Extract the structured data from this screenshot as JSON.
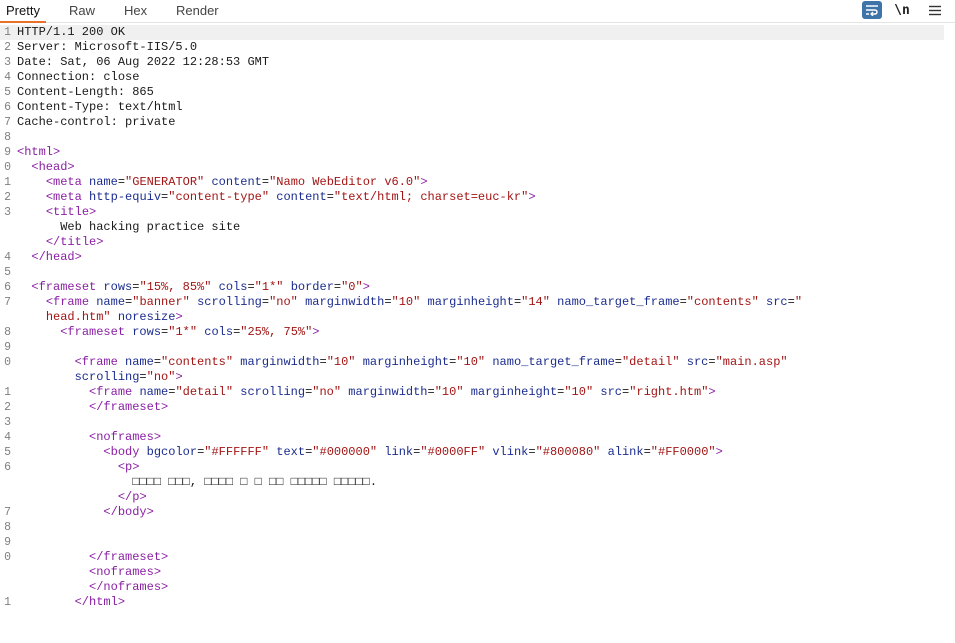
{
  "tabs": [
    {
      "label": "Pretty",
      "active": true
    },
    {
      "label": "Raw",
      "active": false
    },
    {
      "label": "Hex",
      "active": false
    },
    {
      "label": "Render",
      "active": false
    }
  ],
  "toolbar": {
    "newline_label": "\\n",
    "wrap_icon": "word-wrap-icon",
    "menu_icon": "hamburger-menu-icon"
  },
  "colors": {
    "tag": "#8a1fa3",
    "attribute": "#1c2d8f",
    "value": "#a31515",
    "text": "#1a1a1a",
    "accent": "#e8722c"
  },
  "lines": [
    {
      "n": "1",
      "code": "HTTP/1.1 200 OK"
    },
    {
      "n": "2",
      "code": "Server: Microsoft-IIS/5.0"
    },
    {
      "n": "3",
      "code": "Date: Sat, 06 Aug 2022 12:28:53 GMT"
    },
    {
      "n": "4",
      "code": "Connection: close"
    },
    {
      "n": "5",
      "code": "Content-Length: 865"
    },
    {
      "n": "6",
      "code": "Content-Type: text/html"
    },
    {
      "n": "7",
      "code": "Cache-control: private"
    },
    {
      "n": "8",
      "code": ""
    },
    {
      "n": "9",
      "code": "<html>"
    },
    {
      "n": "0",
      "code": "  <head>"
    },
    {
      "n": "1",
      "code": "    <meta name=\"GENERATOR\" content=\"Namo WebEditor v6.0\">"
    },
    {
      "n": "2",
      "code": "    <meta http-equiv=\"content-type\" content=\"text/html; charset=euc-kr\">"
    },
    {
      "n": "3",
      "code": "    <title>"
    },
    {
      "n": "",
      "code": "      Web hacking practice site"
    },
    {
      "n": "",
      "code": "    </title>"
    },
    {
      "n": "4",
      "code": "  </head>"
    },
    {
      "n": "5",
      "code": ""
    },
    {
      "n": "6",
      "code": "  <frameset rows=\"15%, 85%\" cols=\"1*\" border=\"0\">"
    },
    {
      "n": "7",
      "code": "    <frame name=\"banner\" scrolling=\"no\" marginwidth=\"10\" marginheight=\"14\" namo_target_frame=\"contents\" src=\""
    },
    {
      "n": "",
      "code": "    head.htm\" noresize>"
    },
    {
      "n": "8",
      "code": "      <frameset rows=\"1*\" cols=\"25%, 75%\">"
    },
    {
      "n": "9",
      "code": ""
    },
    {
      "n": "0",
      "code": "        <frame name=\"contents\" marginwidth=\"10\" marginheight=\"10\" namo_target_frame=\"detail\" src=\"main.asp\""
    },
    {
      "n": "",
      "code": "        scrolling=\"no\">"
    },
    {
      "n": "1",
      "code": "          <frame name=\"detail\" scrolling=\"no\" marginwidth=\"10\" marginheight=\"10\" src=\"right.htm\">"
    },
    {
      "n": "2",
      "code": "          </frameset>"
    },
    {
      "n": "3",
      "code": ""
    },
    {
      "n": "4",
      "code": "          <noframes>"
    },
    {
      "n": "5",
      "code": "            <body bgcolor=\"#FFFFFF\" text=\"#000000\" link=\"#0000FF\" vlink=\"#800080\" alink=\"#FF0000\">"
    },
    {
      "n": "6",
      "code": "              <p>"
    },
    {
      "n": "",
      "code": "                □□□□ □□□, □□□□ □ □ □□ □□□□□ □□□□□."
    },
    {
      "n": "",
      "code": "              </p>"
    },
    {
      "n": "7",
      "code": "            </body>"
    },
    {
      "n": "8",
      "code": ""
    },
    {
      "n": "9",
      "code": ""
    },
    {
      "n": "0",
      "code": "          </frameset>"
    },
    {
      "n": "",
      "code": "          <noframes>"
    },
    {
      "n": "",
      "code": "          </noframes>"
    },
    {
      "n": "1",
      "code": "        </html>"
    }
  ]
}
